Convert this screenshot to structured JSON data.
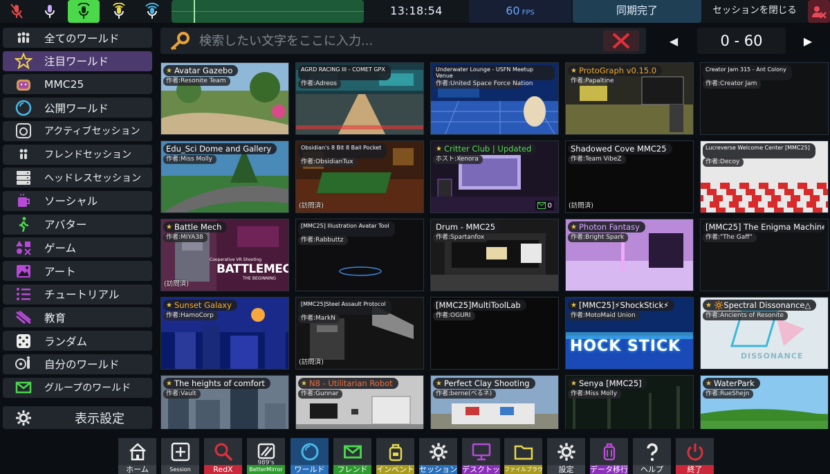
{
  "colors": {
    "accent_green": "#4bd84b",
    "accent_blue": "#6aa8ff",
    "selected_purple": "#4c3a6e",
    "danger_red": "#e0303a",
    "panel_bg": "#22272e"
  },
  "topbar": {
    "mic_icons": [
      "mic-muted-icon",
      "mic-push-to-talk-icon",
      "mic-active-icon",
      "mic-always-on-icon",
      "mic-broadcast-icon"
    ],
    "clock": "13:18:54",
    "fps_value": "60",
    "fps_unit": "FPS",
    "sync_status": "同期完了",
    "close_session": "セッションを閉じる"
  },
  "sidebar": {
    "items": [
      {
        "icon": "people-icon",
        "label": "全てのワールド"
      },
      {
        "icon": "star-icon",
        "label": "注目ワールド"
      },
      {
        "icon": "mmc-toast-icon",
        "label": "MMC25"
      },
      {
        "icon": "public-circle-icon",
        "label": "公開ワールド"
      },
      {
        "icon": "active-session-icon",
        "label": "アクティブセッション"
      },
      {
        "icon": "friends-icon",
        "label": "フレンドセッション"
      },
      {
        "icon": "server-icon",
        "label": "ヘッドレスセッション"
      },
      {
        "icon": "coffee-mug-icon",
        "label": "ソーシャル"
      },
      {
        "icon": "walking-person-icon",
        "label": "アバター"
      },
      {
        "icon": "shapes-icon",
        "label": "ゲーム"
      },
      {
        "icon": "picture-icon",
        "label": "アート"
      },
      {
        "icon": "list-icon",
        "label": "チュートリアル"
      },
      {
        "icon": "education-icon",
        "label": "教育"
      },
      {
        "icon": "dice-icon",
        "label": "ランダム"
      },
      {
        "icon": "my-worlds-icon",
        "label": "自分のワールド"
      },
      {
        "icon": "envelope-icon",
        "label": "グループのワールド"
      }
    ],
    "selected_index": 1,
    "settings_label": "表示設定"
  },
  "search": {
    "placeholder": "検索したい文字をここに入力...",
    "value": ""
  },
  "pager": {
    "range": "0 - 60",
    "prev": "◀",
    "next": "▶"
  },
  "worlds": [
    {
      "title": "Avatar Gazebo",
      "author": "作者:Resonite Team",
      "featured": true,
      "visited": "",
      "users": "",
      "scene": "outdoor-green"
    },
    {
      "title": "AGRD RACING III - COMET GPX",
      "author": "作者:Adreos",
      "featured": false,
      "visited": "",
      "users": "",
      "scene": "race-track"
    },
    {
      "title": "Underwater Lounge - USFN Meetup Venue",
      "author": "作者:United Space Force Nation",
      "featured": false,
      "visited": "",
      "users": "",
      "scene": "lounge-blue"
    },
    {
      "title": "ProtoGraph v0.15.0",
      "author": "作者:Papaltine",
      "featured": true,
      "visited": "",
      "users": "",
      "scene": "workshop"
    },
    {
      "title": "Creator Jam 315 - Ant Colony",
      "author": "作者:Creator Jam",
      "featured": false,
      "visited": "",
      "users": "",
      "scene": "dark"
    },
    {
      "title": "Edu_Sci Dome and Gallery",
      "author": "作者:Miss Molly",
      "featured": false,
      "visited": "",
      "users": "",
      "scene": "outdoor-road"
    },
    {
      "title": "Obsidian's 8 Bit 8 Ball Pocket",
      "author": "作者:ObsidianTux",
      "featured": false,
      "visited": "(訪問済)",
      "users": "",
      "scene": "pool-room"
    },
    {
      "title": "Critter Club | Updated",
      "author": "ホスト:Xenora",
      "featured": true,
      "visited": "",
      "users": "0",
      "scene": "purple-room"
    },
    {
      "title": "Shadowed Cove MMC25",
      "author": "作者:Team VibeZ",
      "featured": false,
      "visited": "(訪問済)",
      "users": "",
      "scene": "black"
    },
    {
      "title": "Lucreverse Welcome Center [MMC25]",
      "author": "作者:Decoy",
      "featured": false,
      "visited": "",
      "users": "",
      "scene": "checker"
    },
    {
      "title": "Battle Mech",
      "author": "作者:MIYA38",
      "featured": true,
      "visited": "(訪問済)",
      "users": "",
      "scene": "battlemech"
    },
    {
      "title": "[MMC25] Illustration Avatar Tool",
      "author": "作者:Rabbuttz",
      "featured": false,
      "visited": "",
      "users": "",
      "scene": "dark-stage"
    },
    {
      "title": "Drum - MMC25",
      "author": "作者:Spartanfox",
      "featured": false,
      "visited": "",
      "users": "",
      "scene": "drum-room"
    },
    {
      "title": "Photon Fantasy",
      "author": "作者:Bright Spark",
      "featured": true,
      "visited": "",
      "users": "",
      "scene": "violet"
    },
    {
      "title": "[MMC25] The Enigma Machine",
      "author": "作者:\"The Gaff\"",
      "featured": false,
      "visited": "",
      "users": "",
      "scene": "dark"
    },
    {
      "title": "Sunset Galaxy",
      "author": "作者:HamoCorp",
      "featured": true,
      "visited": "",
      "users": "",
      "scene": "galaxy"
    },
    {
      "title": "[MMC25]Steel Assault Protocol",
      "author": "作者:MarkN",
      "featured": false,
      "visited": "(訪問済)",
      "users": "",
      "scene": "mech-dark"
    },
    {
      "title": "[MMC25]MultiToolLab",
      "author": "作者:OGURI",
      "featured": false,
      "visited": "",
      "users": "",
      "scene": "black"
    },
    {
      "title": "[MMC25]⚡ShockStick⚡",
      "author": "作者:MotoMaid Union",
      "featured": true,
      "visited": "",
      "users": "",
      "scene": "shockstick"
    },
    {
      "title": "🔆Spectral Dissonance△",
      "author": "作者:Ancients of Resonite",
      "featured": true,
      "visited": "",
      "users": "",
      "scene": "dissonance"
    },
    {
      "title": "The heights of comfort",
      "author": "作者:Vault",
      "featured": true,
      "visited": "",
      "users": "",
      "scene": "city"
    },
    {
      "title": "N8 - Utilitarian Robot",
      "author": "作者:Gunnar",
      "featured": true,
      "visited": "",
      "users": "",
      "scene": "gallery"
    },
    {
      "title": "Perfect Clay Shooting",
      "author": "作者:berne(べるネ)",
      "featured": true,
      "visited": "",
      "users": "",
      "scene": "range"
    },
    {
      "title": "Senya [MMC25]",
      "author": "作者:Miss Molly",
      "featured": true,
      "visited": "",
      "users": "",
      "scene": "forest"
    },
    {
      "title": "WaterPark",
      "author": "作者:RueShejn",
      "featured": true,
      "visited": "",
      "users": "",
      "scene": "park"
    }
  ],
  "tile_overlays": {
    "battlemech_top": "Cooperative VR Shooting",
    "battlemech_logo": "BATTLEMECH",
    "battlemech_sub": "THE BEGINNING",
    "shockstick_logo": "HOCK STICK",
    "dissonance_logo": "DISSONANCE"
  },
  "dock": [
    {
      "icon": "home-icon",
      "label": "ホーム",
      "sub": "",
      "color": "#3a3f46"
    },
    {
      "icon": "plus-box-icon",
      "label": "Session",
      "sub": "",
      "color": "#3a3f46"
    },
    {
      "icon": "magnifier-icon",
      "label": "RedX",
      "sub": "",
      "color": "#c8283a"
    },
    {
      "icon": "striped-box-icon",
      "label": "BetterMirror",
      "sub": "989's",
      "color": "#2f9b2f"
    },
    {
      "icon": "world-circle-icon",
      "label": "ワールド",
      "sub": "",
      "color": "#2a6fb8"
    },
    {
      "icon": "envelope-icon",
      "label": "フレンド",
      "sub": "",
      "color": "#2f9b2f"
    },
    {
      "icon": "backpack-icon",
      "label": "インベントリ",
      "sub": "",
      "color": "#a89b1e"
    },
    {
      "icon": "gear-icon",
      "label": "セッション",
      "sub": "",
      "color": "#2a6fb8"
    },
    {
      "icon": "monitor-icon",
      "label": "デスクトップ",
      "sub": "",
      "color": "#8a2fb8"
    },
    {
      "icon": "folder-icon",
      "label": "ファイルブラウザ",
      "sub": "",
      "color": "#a89b1e"
    },
    {
      "icon": "gear-icon",
      "label": "設定",
      "sub": "",
      "color": "#3a3f46"
    },
    {
      "icon": "luggage-icon",
      "label": "データ移行",
      "sub": "",
      "color": "#8a2fb8"
    },
    {
      "icon": "question-icon",
      "label": "ヘルプ",
      "sub": "",
      "color": "#3a3f46"
    },
    {
      "icon": "power-icon",
      "label": "終了",
      "sub": "",
      "color": "#c8283a"
    }
  ],
  "active_dock_index": 4
}
